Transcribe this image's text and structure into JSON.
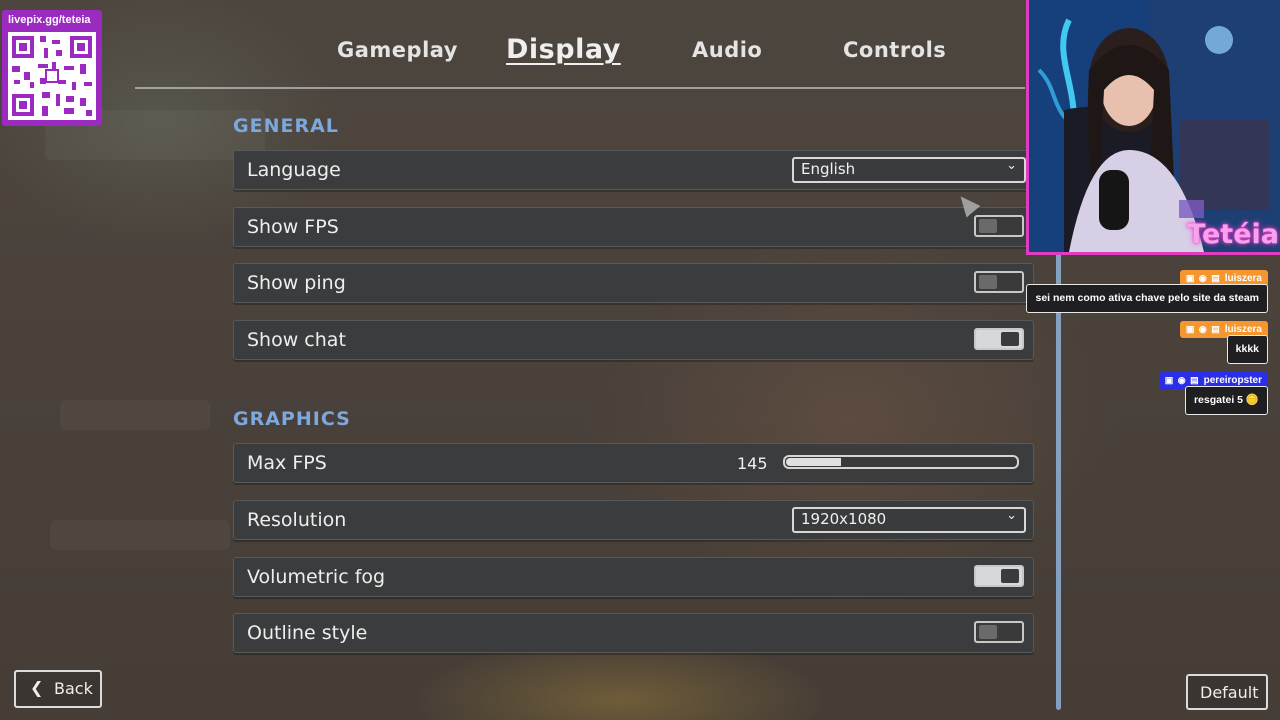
{
  "tabs": [
    {
      "label": "Gameplay"
    },
    {
      "label": "Display"
    },
    {
      "label": "Audio"
    },
    {
      "label": "Controls"
    }
  ],
  "sections": {
    "general": "GENERAL",
    "graphics": "GRAPHICS"
  },
  "general_rows": {
    "language": {
      "label": "Language",
      "value": "English"
    },
    "show_fps": {
      "label": "Show FPS",
      "on": false
    },
    "show_ping": {
      "label": "Show ping",
      "on": false
    },
    "show_chat": {
      "label": "Show chat",
      "on": true
    }
  },
  "graphics_rows": {
    "max_fps": {
      "label": "Max FPS",
      "value": "145",
      "slider_fraction": 0.24
    },
    "resolution": {
      "label": "Resolution",
      "value": "1920x1080"
    },
    "volumetric_fog": {
      "label": "Volumetric fog",
      "on": true
    },
    "outline_style": {
      "label": "Outline style",
      "on": false
    }
  },
  "buttons": {
    "back": "Back",
    "default": "Default"
  },
  "overlay": {
    "qr_url": "livepix.gg/teteia",
    "streamer": "Tetéia"
  },
  "chat": [
    {
      "user": "luiszera",
      "message": "sei nem como ativa chave pelo site da steam",
      "color": "#f5962e"
    },
    {
      "user": "luiszera",
      "message": "kkkk",
      "color": "#f5962e"
    },
    {
      "user": "pereiropster",
      "message": "resgatei 5 🪙",
      "color": "#2a2ee6"
    }
  ],
  "colors": {
    "accent": "#7da8de",
    "qr_purple": "#9b2bc0",
    "streamer_pink": "#e03cc0"
  }
}
